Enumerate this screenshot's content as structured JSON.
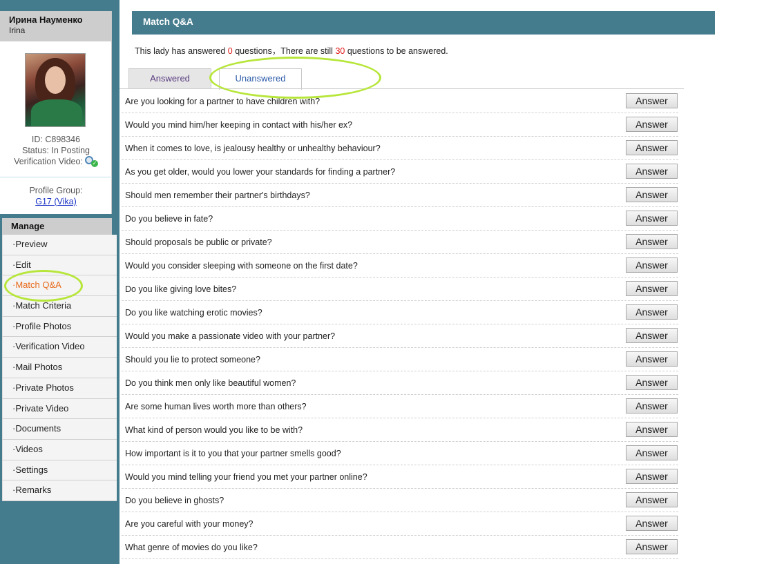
{
  "profile": {
    "name": "Ирина Науменко",
    "subname": "Irina",
    "id_text": "ID: C898346",
    "status_text": "Status: In Posting",
    "verification_label": "Verification Video:",
    "group_label": "Profile Group:",
    "group_link": "G17 (Vika)"
  },
  "manage": {
    "title": "Manage",
    "items": [
      {
        "label": "·Preview"
      },
      {
        "label": "·Edit"
      },
      {
        "label": "·Match Q&A",
        "active": true
      },
      {
        "label": "·Match Criteria"
      },
      {
        "label": "·Profile Photos"
      },
      {
        "label": "·Verification Video"
      },
      {
        "label": "·Mail Photos"
      },
      {
        "label": "·Private Photos"
      },
      {
        "label": "·Private Video"
      },
      {
        "label": "·Documents"
      },
      {
        "label": "·Videos"
      },
      {
        "label": "·Settings"
      },
      {
        "label": "·Remarks"
      }
    ]
  },
  "main": {
    "header": "Match Q&A",
    "summary_prefix": "This lady has answered ",
    "answered_count": "0",
    "summary_mid": " questions，There are still ",
    "remaining_count": "30",
    "summary_suffix": " questions to be answered.",
    "tabs": [
      {
        "label": "Answered"
      },
      {
        "label": "Unanswered"
      }
    ],
    "answer_label": "Answer",
    "questions": [
      "Are you looking for a partner to have children with?",
      "Would you mind him/her keeping in contact with his/her ex?",
      "When it comes to love, is jealousy healthy or unhealthy behaviour?",
      "As you get older, would you lower your standards for finding a partner?",
      "Should men remember their partner's birthdays?",
      "Do you believe in fate?",
      "Should proposals be public or private?",
      "Would you consider sleeping with someone on the first date?",
      "Do you like giving love bites?",
      "Do you like watching erotic movies?",
      "Would you make a passionate video with your partner?",
      "Should you lie to protect someone?",
      "Do you think men only like beautiful women?",
      "Are some human lives worth more than others?",
      "What kind of person would you like to be with?",
      "How important is it to you that your partner smells good?",
      "Would you mind telling your friend you met your partner online?",
      "Do you believe in ghosts?",
      "Are you careful with your money?",
      "What genre of movies do you like?"
    ]
  },
  "colors": {
    "teal": "#447c8e",
    "highlight": "#b7e63a",
    "active_menu": "#e86a1a",
    "count_red": "#e01818"
  }
}
